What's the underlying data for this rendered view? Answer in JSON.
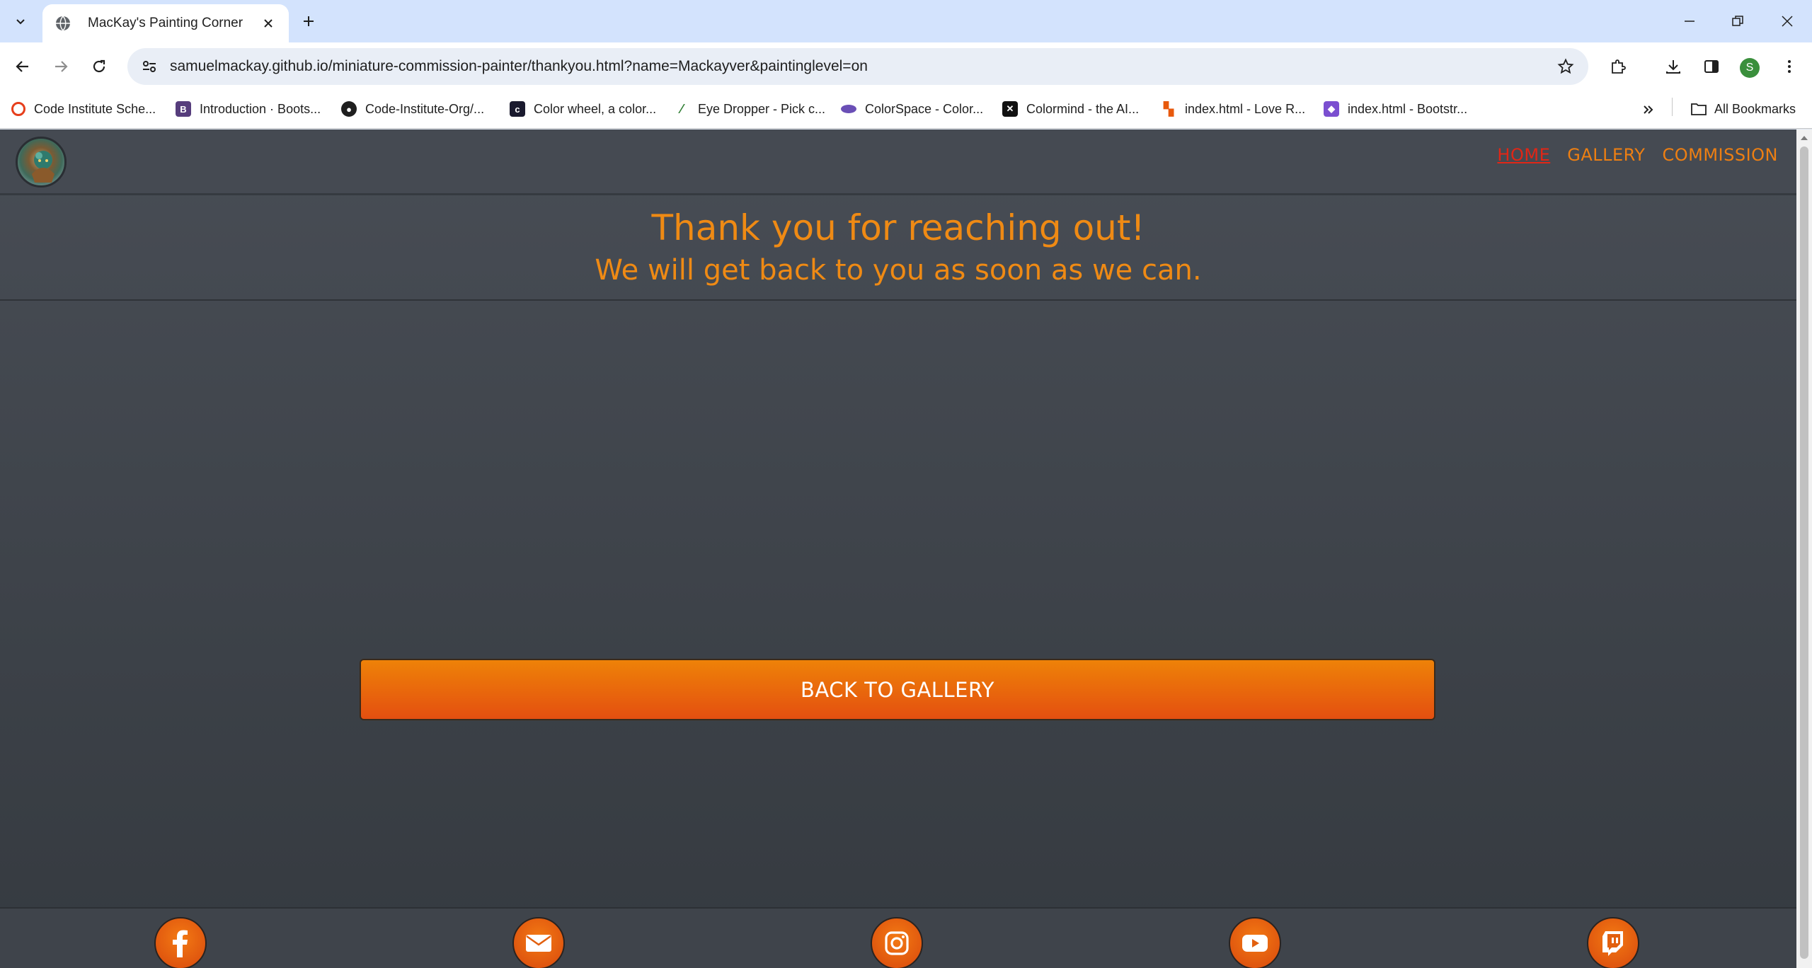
{
  "browser": {
    "tab_title": "MacKay's Painting Corner",
    "url": "samuelmackay.github.io/miniature-commission-painter/thankyou.html?name=Mackayver&paintinglevel=on",
    "profile_initial": "S",
    "bookmarks": [
      {
        "label": "Code Institute Sche...",
        "icon": "code-institute-icon",
        "color": "#e63e1b"
      },
      {
        "label": "Introduction · Boots...",
        "icon": "bootstrap-icon",
        "color": "#563d7c"
      },
      {
        "label": "Code-Institute-Org/...",
        "icon": "github-icon",
        "color": "#1f1f1f"
      },
      {
        "label": "Color wheel, a color...",
        "icon": "color-wheel-icon",
        "color": "#1a1a2e"
      },
      {
        "label": "Eye Dropper - Pick c...",
        "icon": "eyedropper-icon",
        "color": "#2e7d32"
      },
      {
        "label": "ColorSpace - Color...",
        "icon": "colorspace-icon",
        "color": "#6a4fb6"
      },
      {
        "label": "Colormind - the AI...",
        "icon": "colormind-icon",
        "color": "#111111"
      },
      {
        "label": "index.html - Love R...",
        "icon": "love-running-icon",
        "color": "#e8590c"
      },
      {
        "label": "index.html - Bootstr...",
        "icon": "bootstrap-cube-icon",
        "color": "#7b4fd0"
      }
    ],
    "all_bookmarks_label": "All Bookmarks"
  },
  "site": {
    "nav": [
      {
        "label": "HOME",
        "active": true
      },
      {
        "label": "GALLERY",
        "active": false
      },
      {
        "label": "COMMISSION",
        "active": false
      }
    ],
    "heading": "Thank you for reaching out!",
    "subheading": "We will get back to you as soon as we can.",
    "back_button": "BACK TO GALLERY",
    "social": [
      "facebook-icon",
      "email-icon",
      "instagram-icon",
      "youtube-icon",
      "twitch-icon"
    ],
    "colors": {
      "accent": "#ef8a14",
      "nav_active": "#e12616",
      "button_top": "#ee8208",
      "button_bottom": "#e44f10",
      "background": "#41464d"
    }
  }
}
